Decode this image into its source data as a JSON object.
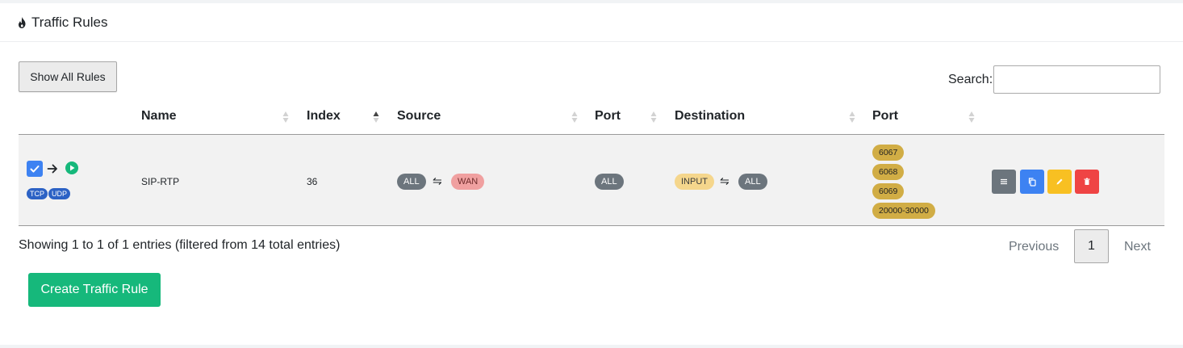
{
  "header": {
    "title": "Traffic Rules",
    "icon": "fire-icon"
  },
  "toolbar": {
    "show_all_label": "Show All Rules",
    "search_label": "Search:",
    "search_value": ""
  },
  "table": {
    "columns": [
      "Name",
      "Index",
      "Source",
      "Port",
      "Destination",
      "Port"
    ],
    "sorted_column": "Index",
    "rows": [
      {
        "enabled": true,
        "protocols": [
          "TCP",
          "UDP"
        ],
        "name": "SIP-RTP",
        "index": "36",
        "source": [
          "ALL",
          "WAN"
        ],
        "source_port": "ALL",
        "destination": [
          "INPUT",
          "ALL"
        ],
        "destination_ports": [
          "6067",
          "6068",
          "6069",
          "20000-30000"
        ],
        "actions": [
          "list-icon",
          "copy-icon",
          "edit-icon",
          "delete-icon"
        ]
      }
    ]
  },
  "symbols": {
    "arrow": "→",
    "swap": "⇋"
  },
  "footer": {
    "info": "Showing 1 to 1 of 1 entries (filtered from 14 total entries)",
    "previous": "Previous",
    "page": "1",
    "next": "Next",
    "create_label": "Create Traffic Rule"
  },
  "colors": {
    "accent_green": "#16b87b",
    "primary_blue": "#3d82f2",
    "warning": "#f8c022",
    "danger": "#ef4444",
    "secondary": "#6c757d"
  }
}
